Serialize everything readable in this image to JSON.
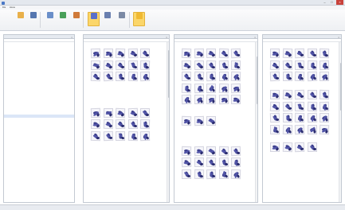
{
  "window": {
    "title": "",
    "controls": [
      "–",
      "□",
      "×"
    ]
  },
  "menu": [
    "File",
    "Home"
  ],
  "toolbar": [
    {
      "name": "open-button",
      "icon": "folder-icon",
      "label": "",
      "color": "#e9b04a"
    },
    {
      "name": "save-button",
      "icon": "save-icon",
      "label": "",
      "color": "#5677b0"
    },
    {
      "name": "export-button",
      "icon": "export-icon",
      "label": "",
      "color": "#6b8fc9"
    },
    {
      "name": "filter-button",
      "icon": "filter-icon",
      "label": "",
      "color": "#4aa05a"
    },
    {
      "name": "settings-button",
      "icon": "gear-icon",
      "label": "",
      "color": "#d07a3a"
    },
    {
      "name": "view-grid-button",
      "icon": "grid-icon",
      "label": "",
      "color": "#5a6fc9"
    },
    {
      "name": "compare-button",
      "icon": "compare-icon",
      "label": "",
      "color": "#6a80b0"
    },
    {
      "name": "zoom-button",
      "icon": "zoom-icon",
      "label": "",
      "color": "#7c8aa5"
    },
    {
      "name": "highlight-button",
      "icon": "highlight-icon",
      "label": "",
      "color": "#f0b932"
    }
  ],
  "left_panel": {
    "title": "",
    "columns": [
      "",
      "",
      ""
    ],
    "rows": [
      {
        "name": "",
        "count": "",
        "total": "",
        "indent": 0
      },
      {
        "name": "",
        "count": "",
        "total": "",
        "indent": 1
      },
      {
        "name": "",
        "count": "",
        "total": "",
        "indent": 1
      },
      {
        "name": "",
        "count": "",
        "total": "",
        "indent": 1
      },
      {
        "name": "",
        "count": "",
        "total": "",
        "indent": 1
      },
      {
        "name": "",
        "count": "",
        "total": "",
        "indent": 1
      },
      {
        "name": "",
        "count": "",
        "total": "",
        "indent": 1
      },
      {
        "name": "",
        "count": "",
        "total": "",
        "indent": 1
      },
      {
        "name": "",
        "count": "",
        "total": "",
        "indent": 1
      },
      {
        "name": "",
        "count": "",
        "total": "",
        "indent": 1
      },
      {
        "name": "",
        "count": "",
        "total": "",
        "indent": 1
      },
      {
        "name": "",
        "count": "",
        "total": "",
        "indent": 1
      },
      {
        "name": "",
        "count": "",
        "total": "",
        "indent": 1
      },
      {
        "name": "",
        "count": "",
        "total": "",
        "indent": 1
      },
      {
        "name": "",
        "count": "",
        "total": "",
        "indent": 1
      },
      {
        "name": "",
        "count": "",
        "total": "",
        "indent": 1
      },
      {
        "name": "",
        "count": "",
        "total": "",
        "indent": 1
      },
      {
        "name": "",
        "count": "",
        "total": "",
        "indent": 0
      },
      {
        "name": "",
        "count": "",
        "total": "",
        "indent": 0
      },
      {
        "name": "",
        "count": "",
        "total": "",
        "indent": 1
      },
      {
        "name": "",
        "count": "",
        "total": "",
        "indent": 2
      },
      {
        "name": "",
        "count": "",
        "total": "",
        "indent": 2
      },
      {
        "name": "",
        "count": "",
        "total": "",
        "indent": 1
      },
      {
        "name": "",
        "count": "",
        "total": "",
        "indent": 1
      },
      {
        "name": "",
        "count": "",
        "total": "",
        "indent": 1
      },
      {
        "name": "",
        "count": "",
        "total": "",
        "indent": 1
      },
      {
        "name": "",
        "count": "",
        "total": "",
        "indent": 1
      },
      {
        "name": "",
        "count": "",
        "total": "",
        "indent": 1
      },
      {
        "name": "",
        "count": "",
        "total": "",
        "indent": 0
      },
      {
        "name": "",
        "count": "",
        "total": "",
        "indent": 1
      },
      {
        "name": "",
        "count": "",
        "total": "",
        "indent": 1
      },
      {
        "name": "",
        "count": "",
        "total": "",
        "indent": 1
      }
    ]
  },
  "result_panels": [
    {
      "title": "",
      "sections": [
        {
          "label": "",
          "rows": 1,
          "cols": 1,
          "kind": "text"
        },
        {
          "label": "",
          "rows": 3,
          "cols": 5,
          "kind": "grid"
        },
        {
          "label": "",
          "rows": 7,
          "cols": 1,
          "kind": "text"
        },
        {
          "label": "",
          "rows": 3,
          "cols": 5,
          "kind": "grid"
        },
        {
          "label": "",
          "rows": 6,
          "cols": 1,
          "kind": "text"
        }
      ]
    },
    {
      "title": "",
      "sections": [
        {
          "label": "",
          "rows": 1,
          "cols": 1,
          "kind": "text"
        },
        {
          "label": "",
          "rows": 5,
          "cols": 5,
          "kind": "grid"
        },
        {
          "label": "",
          "rows": 2,
          "cols": 1,
          "kind": "text"
        },
        {
          "label": "",
          "rows": 1,
          "cols": 3,
          "kind": "grid"
        },
        {
          "label": "",
          "rows": 5,
          "cols": 1,
          "kind": "text"
        },
        {
          "label": "",
          "rows": 3,
          "cols": 5,
          "kind": "grid"
        }
      ]
    },
    {
      "title": "",
      "sections": [
        {
          "label": "",
          "rows": 1,
          "cols": 1,
          "kind": "text"
        },
        {
          "label": "",
          "rows": 3,
          "cols": 5,
          "kind": "grid"
        },
        {
          "label": "",
          "rows": 1,
          "cols": 1,
          "kind": "text"
        },
        {
          "label": "",
          "rows": 4,
          "cols": 5,
          "kind": "grid"
        },
        {
          "label": "",
          "rows": 1,
          "cols": 1,
          "kind": "text"
        },
        {
          "label": "",
          "rows": 1,
          "cols": 4,
          "kind": "grid"
        },
        {
          "label": "",
          "rows": 7,
          "cols": 1,
          "kind": "text"
        }
      ]
    }
  ]
}
